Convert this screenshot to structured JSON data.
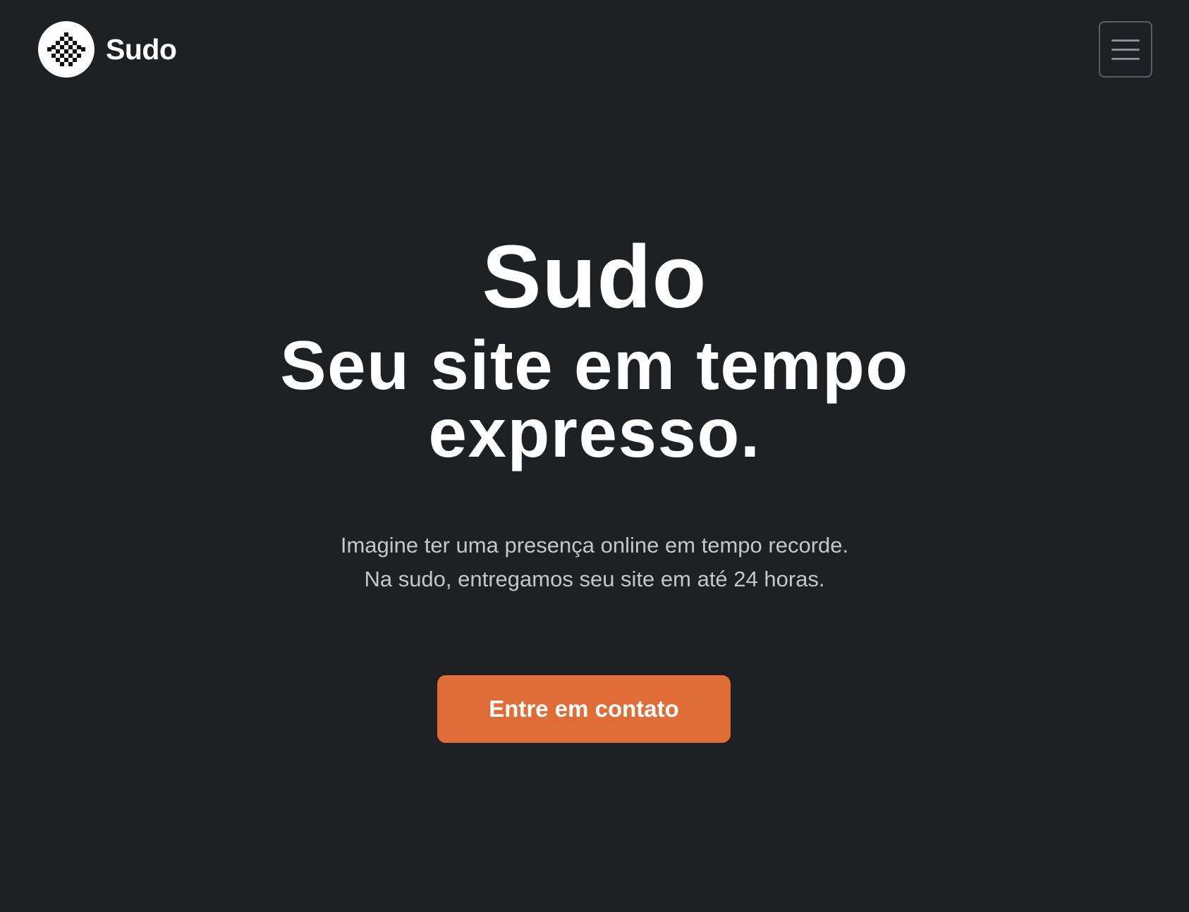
{
  "navbar": {
    "brand_name": "Sudo",
    "menu_toggle_label": "Menu"
  },
  "hero": {
    "title": "Sudo",
    "subtitle_line1": "Seu site em tempo",
    "subtitle_line2": "expresso.",
    "lead_line1": "Imagine ter uma presença online em tempo recorde.",
    "lead_line2": "Na sudo, entregamos seu site em até 24 horas.",
    "cta_label": "Entre em contato"
  },
  "colors": {
    "background": "#1f2024",
    "text": "#ffffff",
    "lead_text": "#c4c6cc",
    "accent": "#e06c37",
    "toggle_border": "#5a5d66"
  },
  "icons": {
    "brand_logo": "sudo-logo-icon",
    "menu": "hamburger-menu-icon"
  }
}
